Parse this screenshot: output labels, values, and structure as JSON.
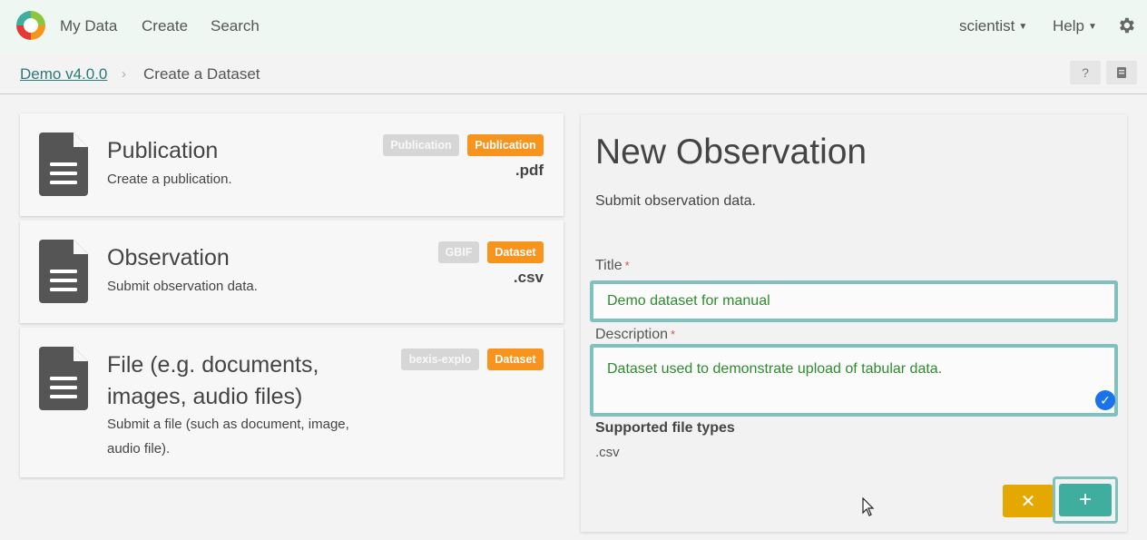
{
  "nav": {
    "items": [
      "My Data",
      "Create",
      "Search"
    ],
    "user": "scientist",
    "help": "Help"
  },
  "breadcrumb": {
    "root": "Demo v4.0.0",
    "separator": "›",
    "current": "Create a Dataset",
    "help_label": "?"
  },
  "cards": [
    {
      "title": "Publication",
      "description": "Create a publication.",
      "badges": [
        "Publication",
        "Publication"
      ],
      "extension": ".pdf"
    },
    {
      "title": "Observation",
      "description": "Submit observation data.",
      "badges": [
        "GBIF",
        "Dataset"
      ],
      "extension": ".csv"
    },
    {
      "title": "File (e.g. documents, images, audio files)",
      "description": "Submit a file (such as document, image, audio file).",
      "badges": [
        "bexis-explo",
        "Dataset"
      ],
      "extension": ""
    }
  ],
  "form": {
    "heading": "New Observation",
    "subtitle": "Submit observation data.",
    "title_label": "Title",
    "title_value": "Demo dataset for manual",
    "required_mark": "*",
    "description_label": "Description",
    "description_value": "Dataset used to demonstrate upload of tabular data.",
    "supported_label": "Supported file types",
    "supported_value": ".csv",
    "cancel_label": "✕",
    "add_label": "+"
  },
  "colors": {
    "accent": "#3fae9e",
    "orange_badge": "#f7941d",
    "grey_badge": "#d6d6d6",
    "cancel": "#e4a800",
    "focus_border": "#7fc1bc"
  },
  "icons": [
    "bexis-logo-icon",
    "gear-icon",
    "document-icon",
    "help-icon",
    "book-icon",
    "check-icon",
    "cursor-icon"
  ]
}
